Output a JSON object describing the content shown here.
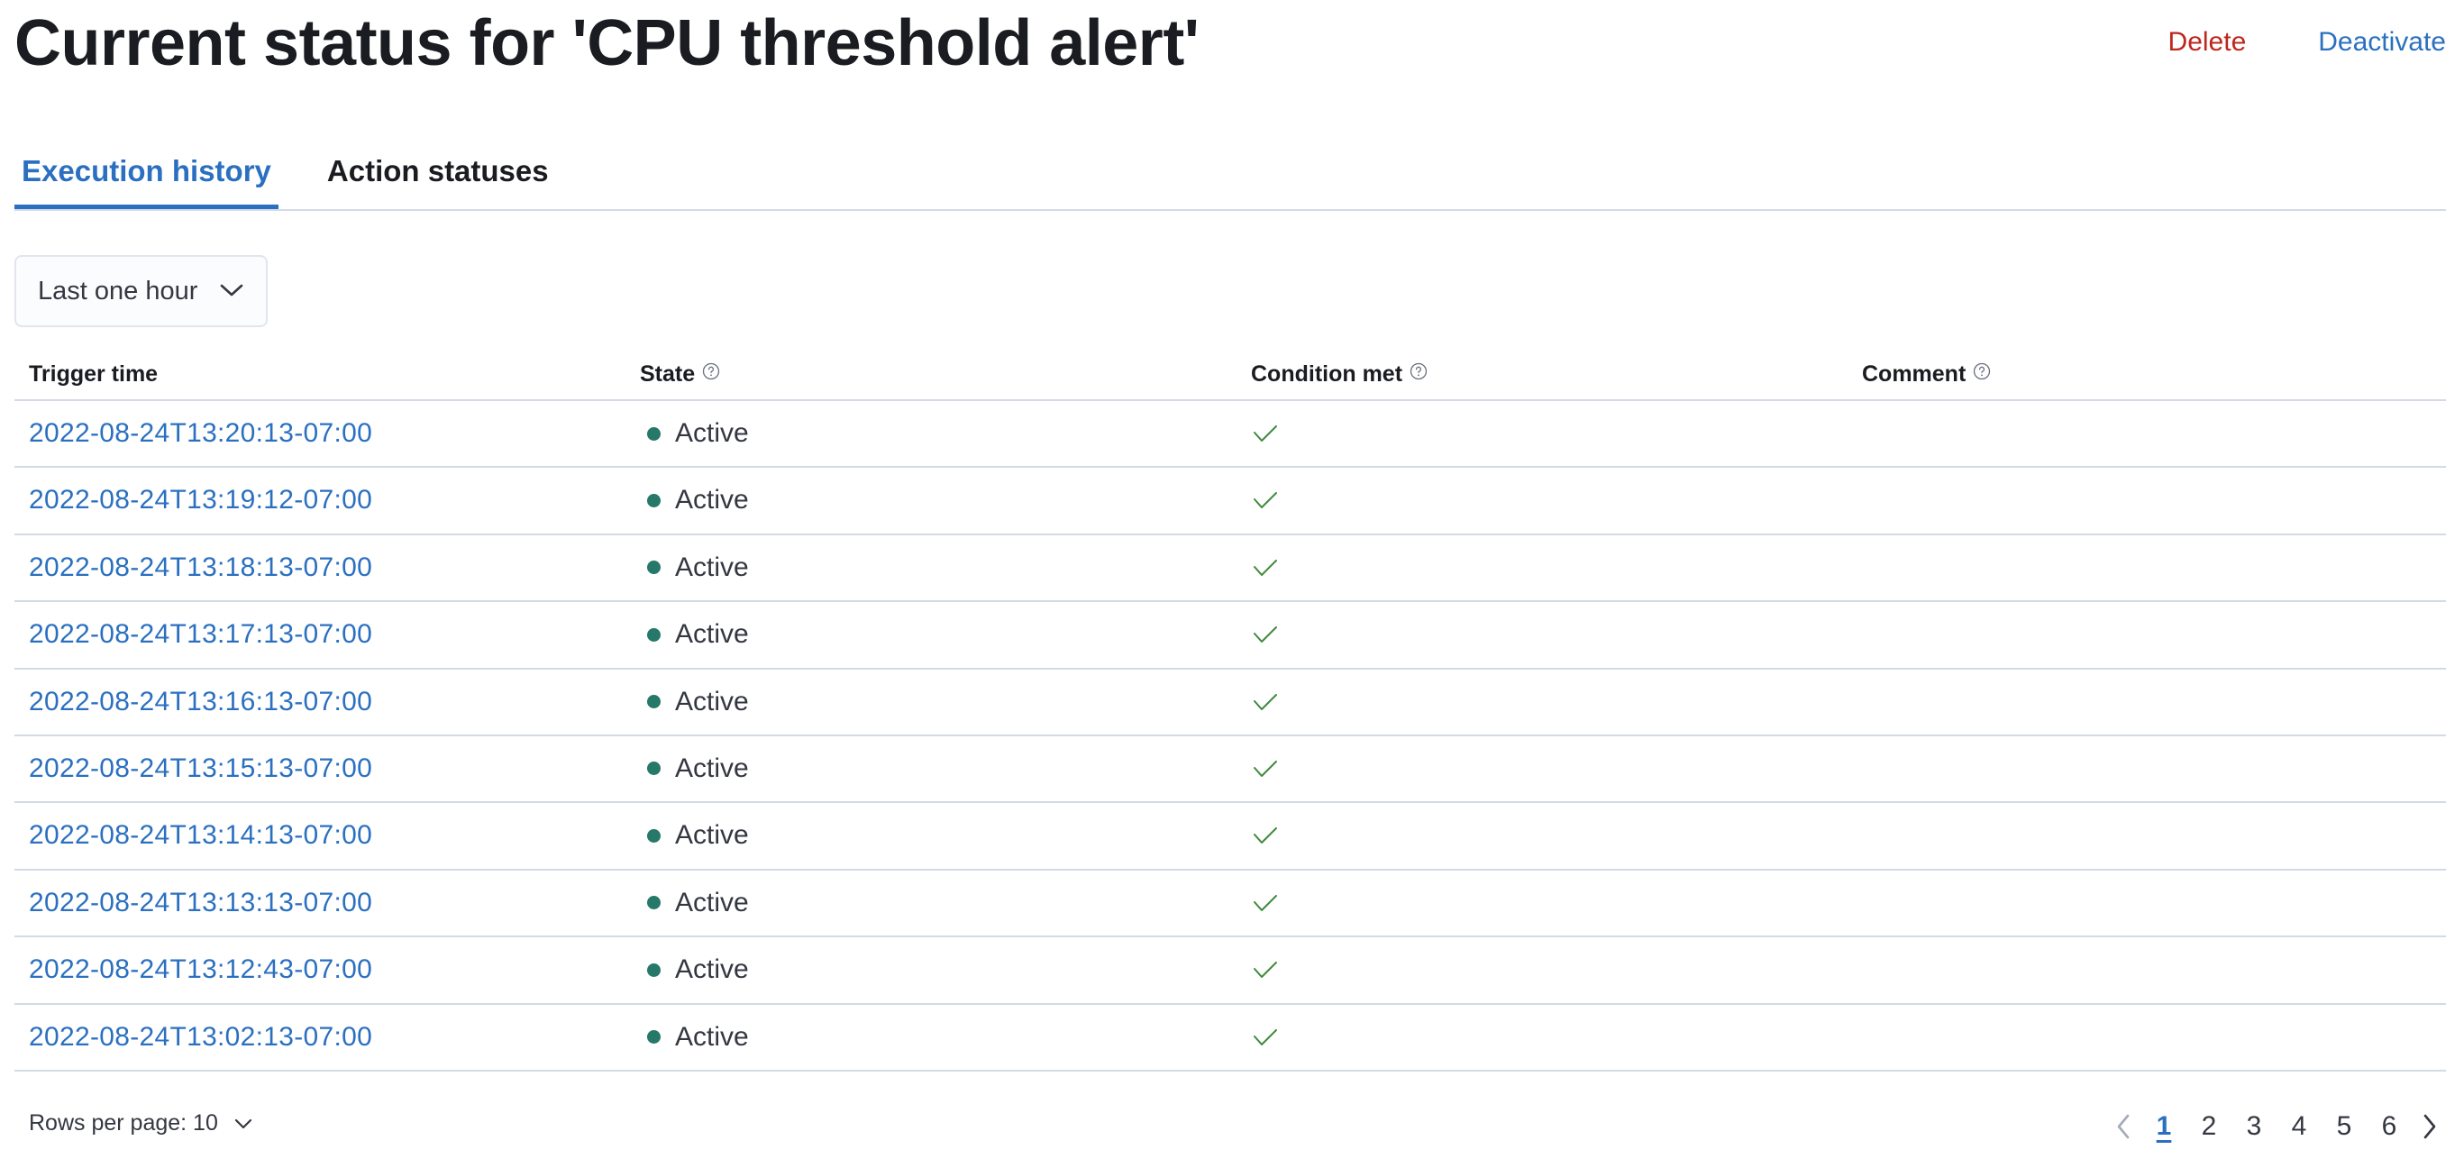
{
  "header": {
    "title": "Current status for 'CPU threshold alert'",
    "actions": {
      "delete_label": "Delete",
      "deactivate_label": "Deactivate"
    }
  },
  "tabs": [
    {
      "label": "Execution history",
      "active": true
    },
    {
      "label": "Action statuses",
      "active": false
    }
  ],
  "time_filter": {
    "selected": "Last one hour",
    "icon": "chevron-down-icon"
  },
  "table": {
    "columns": [
      {
        "label": "Trigger time",
        "has_help": false
      },
      {
        "label": "State",
        "has_help": true
      },
      {
        "label": "Condition met",
        "has_help": true
      },
      {
        "label": "Comment",
        "has_help": true
      }
    ],
    "rows": [
      {
        "trigger_time": "2022-08-24T13:20:13-07:00",
        "state": "Active",
        "condition_met": true,
        "comment": ""
      },
      {
        "trigger_time": "2022-08-24T13:19:12-07:00",
        "state": "Active",
        "condition_met": true,
        "comment": ""
      },
      {
        "trigger_time": "2022-08-24T13:18:13-07:00",
        "state": "Active",
        "condition_met": true,
        "comment": ""
      },
      {
        "trigger_time": "2022-08-24T13:17:13-07:00",
        "state": "Active",
        "condition_met": true,
        "comment": ""
      },
      {
        "trigger_time": "2022-08-24T13:16:13-07:00",
        "state": "Active",
        "condition_met": true,
        "comment": ""
      },
      {
        "trigger_time": "2022-08-24T13:15:13-07:00",
        "state": "Active",
        "condition_met": true,
        "comment": ""
      },
      {
        "trigger_time": "2022-08-24T13:14:13-07:00",
        "state": "Active",
        "condition_met": true,
        "comment": ""
      },
      {
        "trigger_time": "2022-08-24T13:13:13-07:00",
        "state": "Active",
        "condition_met": true,
        "comment": ""
      },
      {
        "trigger_time": "2022-08-24T13:12:43-07:00",
        "state": "Active",
        "condition_met": true,
        "comment": ""
      },
      {
        "trigger_time": "2022-08-24T13:02:13-07:00",
        "state": "Active",
        "condition_met": true,
        "comment": ""
      }
    ]
  },
  "footer": {
    "rows_per_page_label": "Rows per page: 10",
    "pagination": {
      "current_page": 1,
      "pages": [
        "1",
        "2",
        "3",
        "4",
        "5",
        "6"
      ],
      "prev_disabled": true,
      "next_disabled": false
    }
  },
  "colors": {
    "accent": "#2b70c0",
    "danger": "#bd271e",
    "status_active": "#267868",
    "check": "#3f8a3c",
    "border": "#d3dae6",
    "text": "#1a1c21"
  }
}
